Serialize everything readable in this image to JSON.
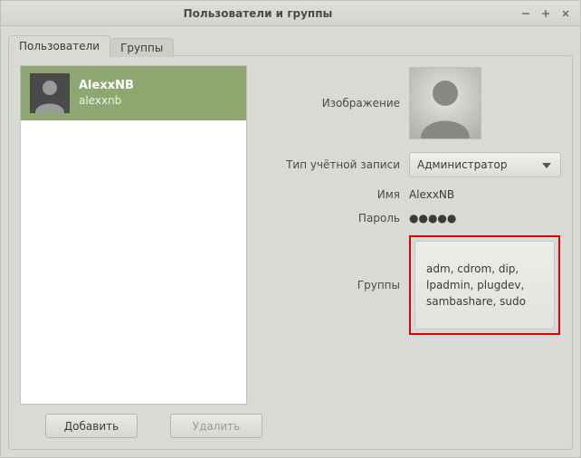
{
  "window": {
    "title": "Пользователи и группы"
  },
  "tabs": {
    "users": "Пользователи",
    "groups": "Группы"
  },
  "userlist": {
    "items": [
      {
        "display": "AlexxNB",
        "login": "alexxnb"
      }
    ]
  },
  "labels": {
    "image": "Изображение",
    "account_type": "Тип учётной записи",
    "name": "Имя",
    "password": "Пароль",
    "groups": "Группы"
  },
  "details": {
    "account_type_value": "Администратор",
    "name_value": "AlexxNB",
    "password_value": "●●●●●",
    "groups_value": "adm, cdrom, dip, lpadmin, plugdev, sambashare, sudo"
  },
  "buttons": {
    "add": "Добавить",
    "delete": "Удалить"
  }
}
